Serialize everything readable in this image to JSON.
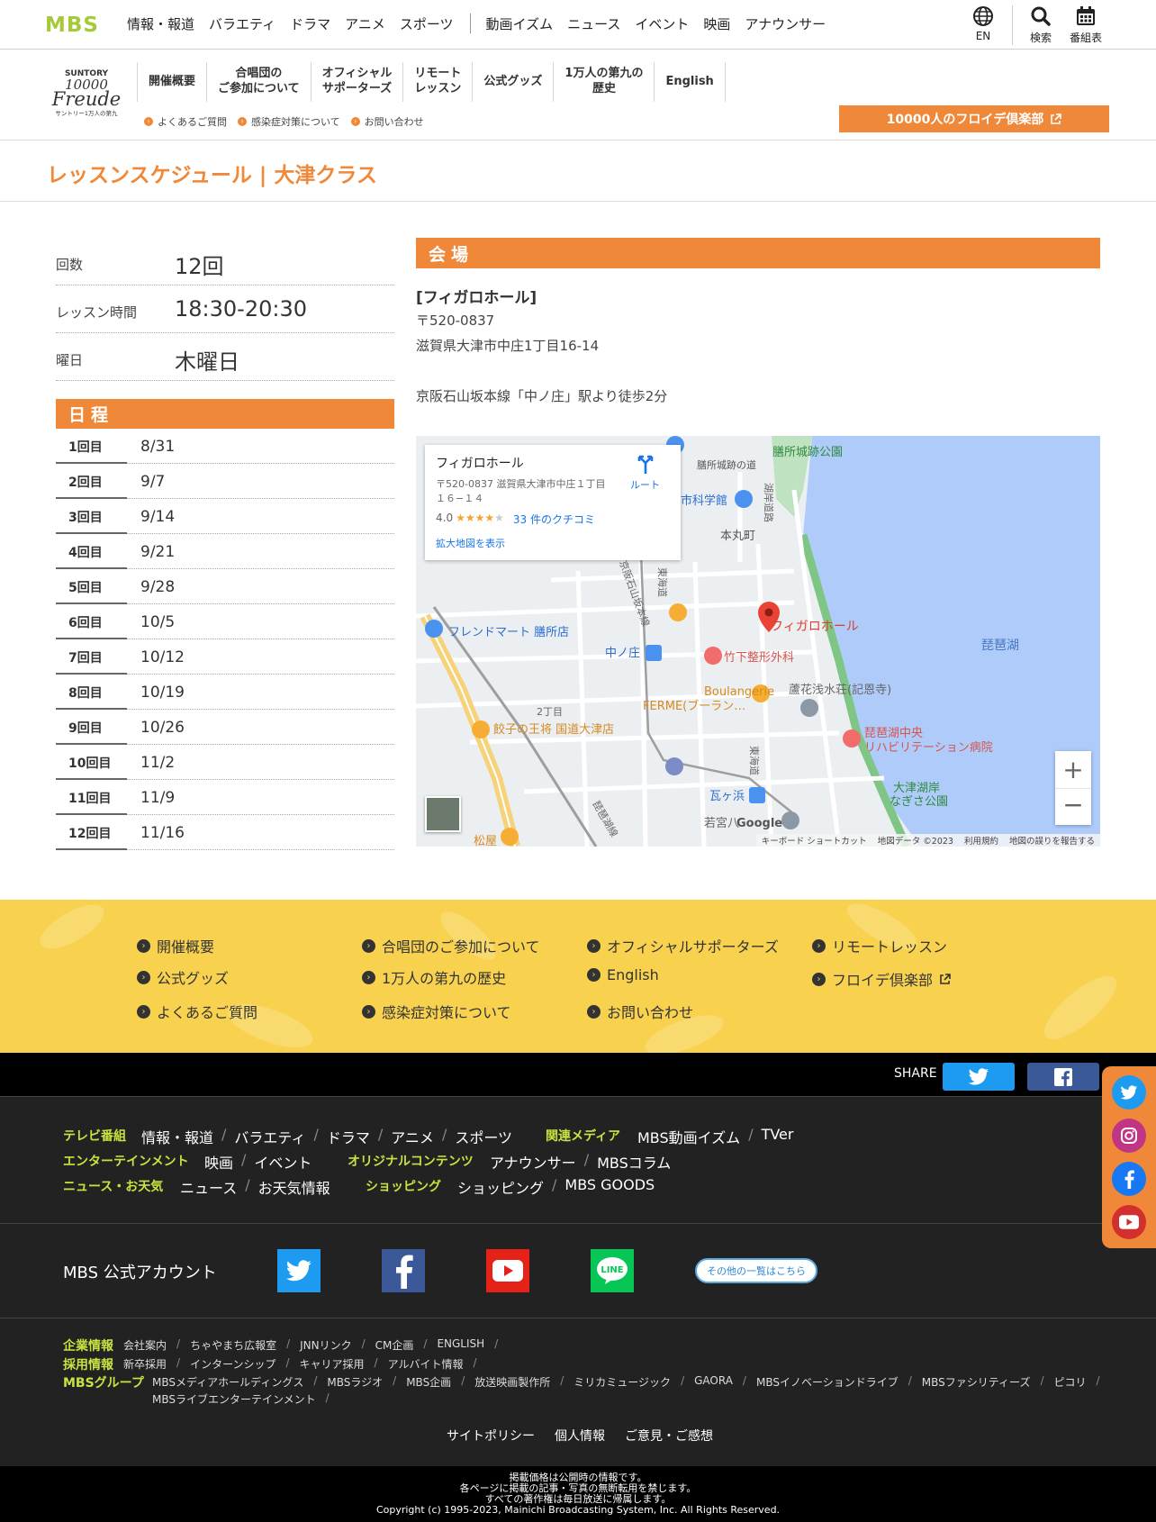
{
  "header": {
    "logo": "MBS",
    "nav": [
      "情報・報道",
      "バラエティ",
      "ドラマ",
      "アニメ",
      "スポーツ"
    ],
    "nav2": [
      "動画イズム",
      "ニュース",
      "イベント",
      "映画",
      "アナウンサー"
    ],
    "lang": "EN",
    "search": "検索",
    "schedule": "番組表"
  },
  "subnav": {
    "logo_top": "SUNTORY",
    "logo_mid": "10000",
    "logo_script": "Freude",
    "logo_bottom": "サントリー1万人の第九",
    "tabs": [
      "開催概要",
      "合唱団の\nご参加について",
      "オフィシャル\nサポーターズ",
      "リモート\nレッスン",
      "公式グッズ",
      "1万人の第九の\n歴史",
      "English"
    ],
    "links": [
      "よくあるご質問",
      "感染症対策について",
      "お問い合わせ"
    ],
    "club_button": "10000人のフロイデ倶楽部"
  },
  "page": {
    "title": "レッスンスケジュール | 大津クラス"
  },
  "info": [
    {
      "label": "回数",
      "value": "12回"
    },
    {
      "label": "レッスン時間",
      "value": "18:30-20:30"
    },
    {
      "label": "曜日",
      "value": "木曜日"
    }
  ],
  "schedule": {
    "heading": "日程",
    "rows": [
      {
        "n": "1回目",
        "d": "8/31"
      },
      {
        "n": "2回目",
        "d": "9/7"
      },
      {
        "n": "3回目",
        "d": "9/14"
      },
      {
        "n": "4回目",
        "d": "9/21"
      },
      {
        "n": "5回目",
        "d": "9/28"
      },
      {
        "n": "6回目",
        "d": "10/5"
      },
      {
        "n": "7回目",
        "d": "10/12"
      },
      {
        "n": "8回目",
        "d": "10/19"
      },
      {
        "n": "9回目",
        "d": "10/26"
      },
      {
        "n": "10回目",
        "d": "11/2"
      },
      {
        "n": "11回目",
        "d": "11/9"
      },
      {
        "n": "12回目",
        "d": "11/16"
      }
    ]
  },
  "venue": {
    "heading": "会場",
    "name": "[フィガロホール]",
    "postal": "〒520-0837",
    "address": "滋賀県大津市中庄1丁目16-14",
    "access": "京阪石山坂本線「中ノ庄」駅より徒歩2分"
  },
  "map": {
    "card_title": "フィガロホール",
    "card_address_1": "〒520-0837 滋賀県大津市中庄１丁目",
    "card_address_2": "１６−１４",
    "rating": "4.0",
    "stars": "★★★★",
    "reviews": "33 件のクチコミ",
    "enlarge": "拡大地図を表示",
    "route": "ルート",
    "labels": {
      "park1": "膳所城跡公園",
      "road1": "膳所城跡の道",
      "sci": "市科学館",
      "town": "本丸町",
      "mart": "フレンドマート 膳所店",
      "station": "中ノ庄",
      "figaro": "フィガロホール",
      "clinic": "竹下整形外科",
      "bakery1": "Boulangerie",
      "bakery2": "FERME(ブーラン…",
      "villa": "蘆花浅水荘(記恩寺)",
      "lake": "琵琶湖",
      "chome": "2丁目",
      "gyoza": "餃子の王将 国道大津店",
      "hosp1": "琵琶湖中央",
      "hosp2": "リハビリテーション病院",
      "park2a": "大津湖岸",
      "park2b": "なぎさ公園",
      "warehama": "瓦ヶ浜",
      "wakamiya": "若宮八",
      "matsuya": "松屋",
      "rail1": "京阪石山坂本線",
      "tokaido": "東海道",
      "lakeside": "湖岸道路",
      "kiln": "琵琶湖線",
      "google": "Google",
      "shortcut": "キーボード ショートカット",
      "mapdata": "地図データ ©2023",
      "terms": "利用規約",
      "report": "地図の誤りを報告する"
    }
  },
  "footer_links": [
    [
      "開催概要",
      "合唱団のご参加について",
      "オフィシャルサポーターズ",
      "リモートレッスン"
    ],
    [
      "公式グッズ",
      "1万人の第九の歴史",
      "English",
      "フロイデ倶楽部"
    ],
    [
      "よくあるご質問",
      "感染症対策について",
      "お問い合わせ"
    ]
  ],
  "share": {
    "label": "SHARE"
  },
  "footer": {
    "cat_tv": "テレビ番組",
    "tv": [
      "情報・報道",
      "バラエティ",
      "ドラマ",
      "アニメ",
      "スポーツ"
    ],
    "cat_media": "関連メディア",
    "media": [
      "MBS動画イズム",
      "TVer"
    ],
    "cat_ent": "エンターテインメント",
    "ent": [
      "映画",
      "イベント"
    ],
    "cat_orig": "オリジナルコンテンツ",
    "orig": [
      "アナウンサー",
      "MBSコラム"
    ],
    "cat_news": "ニュース・お天気",
    "news": [
      "ニュース",
      "お天気情報"
    ],
    "cat_shop": "ショッピング",
    "shop": [
      "ショッピング",
      "MBS GOODS"
    ],
    "accounts_label": "MBS 公式アカウント",
    "more": "その他の一覧はこちら",
    "cat_corp": "企業情報",
    "corp": [
      "会社案内",
      "ちゃやまち広報室",
      "JNNリンク",
      "CM企画",
      "ENGLISH"
    ],
    "cat_recruit": "採用情報",
    "recruit": [
      "新卒採用",
      "インターンシップ",
      "キャリア採用",
      "アルバイト情報"
    ],
    "cat_group": "MBSグループ",
    "group1": [
      "MBSメディアホールディングス",
      "MBSラジオ",
      "MBS企画",
      "放送映画製作所",
      "ミリカミュージック",
      "GAORA",
      "MBSイノベーションドライブ",
      "MBSファシリティーズ",
      "ピコリ"
    ],
    "group2": [
      "MBSライブエンターテインメント"
    ],
    "policy": [
      "サイトポリシー",
      "個人情報",
      "ご意見・ご感想"
    ],
    "legal1": "掲載価格は公開時の情報です。",
    "legal2": "各ページに掲載の記事・写真の無断転用を禁じます。",
    "legal3": "すべての著作権は毎日放送に帰属します。",
    "copyright": "Copyright (c) 1995-2023, Mainichi Broadcasting System, Inc. All Rights Reserved."
  },
  "colors": {
    "accent": "#f0883a",
    "lime": "#a6c93a",
    "yellow": "#f8d24f",
    "footer": "#222222"
  }
}
